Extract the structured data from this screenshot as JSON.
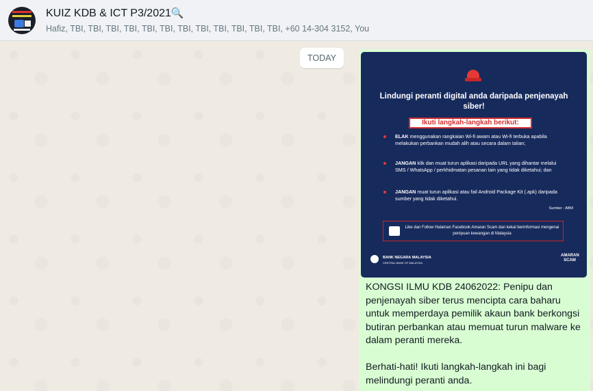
{
  "header": {
    "title": "KUIZ KDB & ICT P3/2021",
    "title_icon": "🔍",
    "participants": "Hafiz, TBI, TBI, TBI, TBI, TBI, TBI, TBI, TBI, TBI, TBI, TBI, TBI, +60 14-304 3152, You"
  },
  "chat": {
    "date_divider": "TODAY",
    "poster": {
      "title": "Lindungi peranti digital anda daripada penjenayah siber!",
      "banner": "Ikuti langkah-langkah berikut:",
      "items": [
        {
          "keyword": "ELAK",
          "text": " menggunakan rangkaian Wi-fi awam atau Wi-fi terbuka apabila melakukan perbankan mudah alih atau secara dalam talian;"
        },
        {
          "keyword": "JANGAN",
          "text": " klik dan muat turun aplikasi daripada URL yang dihantar melalui SMS / WhatsApp / perkhidmatan pesanan lain yang tidak diketahui; dan"
        },
        {
          "keyword": "JANGAN",
          "text": " muat turun aplikasi atau fail Android Package Kit (.apk) daripada sumber yang tidak diketahui."
        }
      ],
      "source": "Sumber : ABM",
      "follow_text": "Like dan Follow Halaman Facebook Amaran Scam dan kekal berinformasi mengenai penipuan kewangan di Malaysia",
      "bank_name": "BANK NEGARA MALAYSIA",
      "bank_sub": "CENTRAL BANK OF MALAYSIA",
      "scam_logo_top": "AMARAN",
      "scam_logo_bottom": "SCAM"
    },
    "message": {
      "paragraph1": "KONGSI ILMU KDB 24062022: Penipu dan penjenayah siber terus mencipta cara baharu untuk memperdaya pemilik akaun bank berkongsi butiran perbankan atau memuat turun malware ke dalam peranti mereka.",
      "paragraph2": "Berhati-hati! Ikuti langkah-langkah ini bagi melindungi peranti anda."
    }
  },
  "colors": {
    "header_bg": "#f0f2f5",
    "chat_bg": "#efeae2",
    "outgoing_bubble": "#d9fdd3",
    "poster_bg": "#172a5c",
    "alert_red": "#d32f2f"
  }
}
